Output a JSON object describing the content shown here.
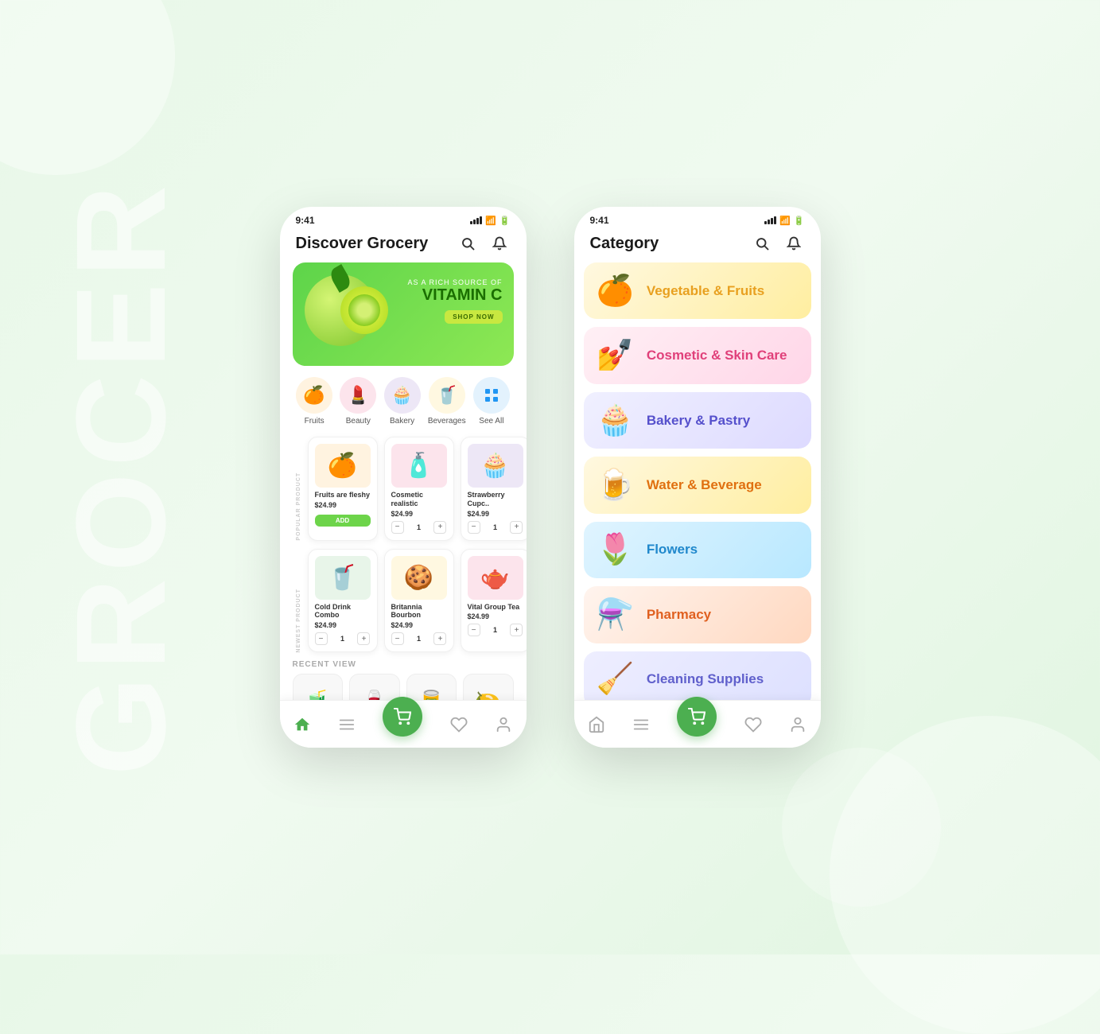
{
  "background": {
    "watermark": "GROCER"
  },
  "phone_left": {
    "status_bar": {
      "time": "9:41"
    },
    "header": {
      "title": "Discover Grocery",
      "search_label": "search",
      "bell_label": "notifications"
    },
    "banner": {
      "subtitle": "AS A RICH SOURCE OF",
      "title": "VITAMIN C",
      "button": "SHOP NOW"
    },
    "categories": [
      {
        "id": "fruits",
        "label": "Fruits",
        "icon": "🍊",
        "bg": "#fff3e0"
      },
      {
        "id": "beauty",
        "label": "Beauty",
        "icon": "💄",
        "bg": "#fce4ec"
      },
      {
        "id": "bakery",
        "label": "Bakery",
        "icon": "🧁",
        "bg": "#ede7f6"
      },
      {
        "id": "beverages",
        "label": "Beverages",
        "icon": "🥤",
        "bg": "#fff8e1"
      },
      {
        "id": "see-all",
        "label": "See All",
        "icon": "⊞",
        "bg": "#e3f2fd"
      }
    ],
    "popular_products": {
      "section_label": "POPULAR PRODUCT",
      "items": [
        {
          "name": "Fruits are fleshy",
          "price": "$24.99",
          "icon": "🍊",
          "has_add": true
        },
        {
          "name": "Cosmetic realistic",
          "price": "$24.99",
          "icon": "🧴",
          "has_add": false,
          "qty": 1
        },
        {
          "name": "Strawberry Cupc..",
          "price": "$24.99",
          "icon": "🧁",
          "has_add": false,
          "qty": 1
        }
      ]
    },
    "newest_products": {
      "section_label": "NEWEST PRODUCT",
      "items": [
        {
          "name": "Cold Drink Combo",
          "price": "$24.99",
          "icon": "🥤",
          "has_add": false,
          "qty": 1
        },
        {
          "name": "Britannia Bourbon",
          "price": "$24.99",
          "icon": "🍪",
          "has_add": false,
          "qty": 1
        },
        {
          "name": "Vital Group Tea",
          "price": "$24.99",
          "icon": "🫖",
          "has_add": false,
          "qty": 1
        }
      ]
    },
    "recent_view": {
      "label": "RECENT VIEW",
      "items": [
        "🧃",
        "🍷",
        "🥫",
        "🍋"
      ]
    },
    "bottom_nav": [
      {
        "id": "home",
        "icon": "⌂",
        "active": true
      },
      {
        "id": "menu",
        "icon": "≡",
        "active": false
      },
      {
        "id": "cart",
        "icon": "🛒",
        "active": false,
        "is_center": true
      },
      {
        "id": "favorites",
        "icon": "♡",
        "active": false
      },
      {
        "id": "profile",
        "icon": "👤",
        "active": false
      }
    ]
  },
  "phone_right": {
    "status_bar": {
      "time": "9:41"
    },
    "header": {
      "title": "Category",
      "search_label": "search",
      "bell_label": "notifications"
    },
    "categories": [
      {
        "id": "veg-fruits",
        "name": "Vegetable & Fruits",
        "icon": "🍊",
        "style": "cat-veg"
      },
      {
        "id": "cosmetic",
        "name": "Cosmetic & Skin Care",
        "icon": "💅",
        "style": "cat-cosmetic"
      },
      {
        "id": "bakery",
        "name": "Bakery & Pastry",
        "icon": "🧁",
        "style": "cat-bakery"
      },
      {
        "id": "water",
        "name": "Water & Beverage",
        "icon": "🍺",
        "style": "cat-water"
      },
      {
        "id": "flowers",
        "name": "Flowers",
        "icon": "🌷",
        "style": "cat-flowers"
      },
      {
        "id": "pharmacy",
        "name": "Pharmacy",
        "icon": "⚗️",
        "style": "cat-pharmacy"
      },
      {
        "id": "cleaning",
        "name": "Cleaning Supplies",
        "icon": "🧹",
        "style": "cat-cleaning"
      }
    ],
    "bottom_nav": [
      {
        "id": "home",
        "icon": "⌂",
        "active": false
      },
      {
        "id": "menu",
        "icon": "≡",
        "active": false
      },
      {
        "id": "cart",
        "icon": "🛒",
        "active": false,
        "is_center": true
      },
      {
        "id": "favorites",
        "icon": "♡",
        "active": false
      },
      {
        "id": "profile",
        "icon": "👤",
        "active": false
      }
    ]
  }
}
